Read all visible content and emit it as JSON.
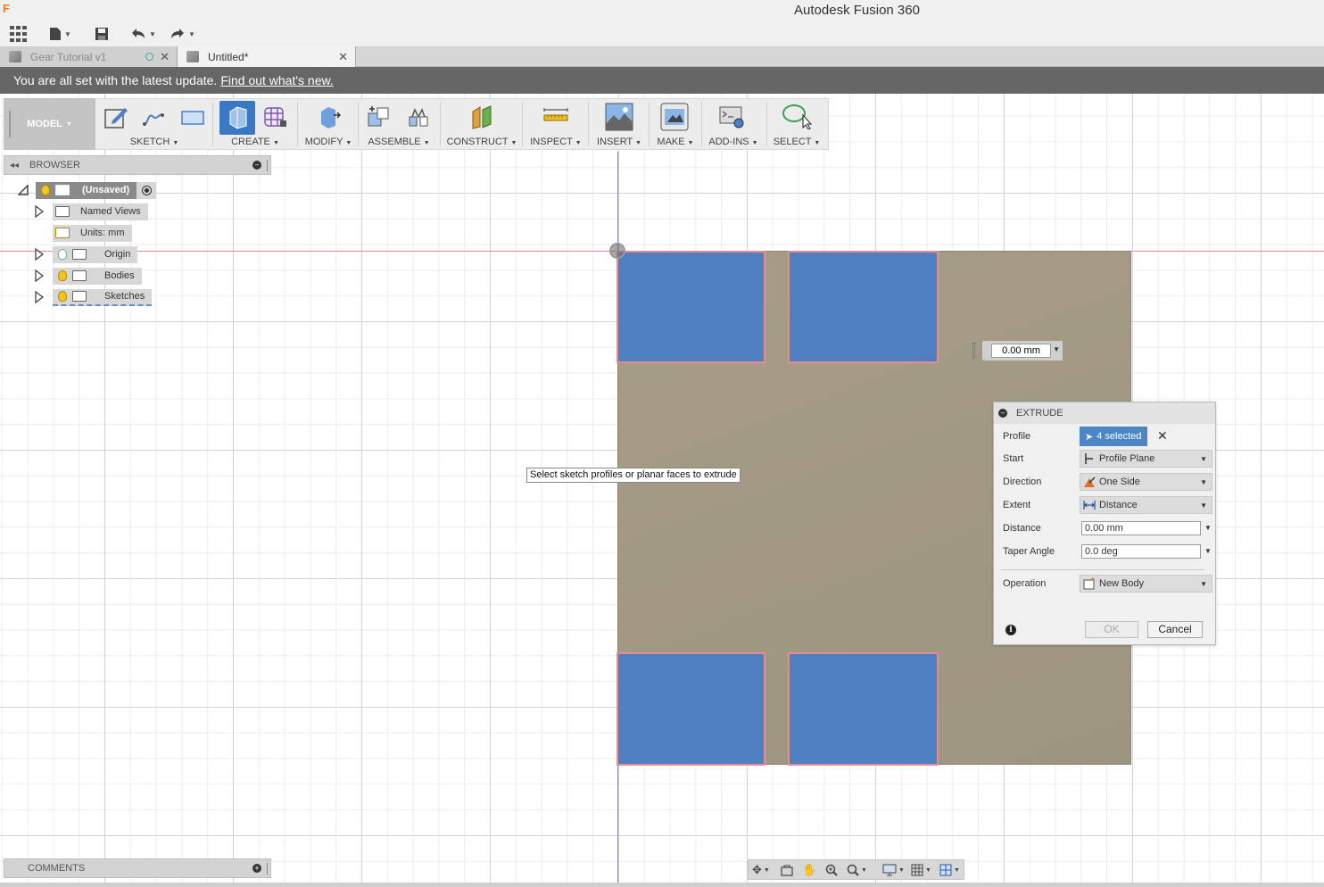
{
  "app": {
    "title": "Autodesk Fusion 360",
    "logo_letter": "F"
  },
  "tabs": [
    {
      "label": "Gear Tutorial v1",
      "active": false
    },
    {
      "label": "Untitled*",
      "active": true
    }
  ],
  "banner": {
    "text": "You are all set with the latest update.",
    "link": "Find out what's new."
  },
  "ribbon": {
    "workspace": "MODEL",
    "groups": [
      "SKETCH",
      "CREATE",
      "MODIFY",
      "ASSEMBLE",
      "CONSTRUCT",
      "INSPECT",
      "INSERT",
      "MAKE",
      "ADD-INS",
      "SELECT"
    ]
  },
  "browser": {
    "title": "BROWSER",
    "items": [
      {
        "label": "(Unsaved)"
      },
      {
        "label": "Named Views"
      },
      {
        "label": "Units: mm"
      },
      {
        "label": "Origin"
      },
      {
        "label": "Bodies"
      },
      {
        "label": "Sketches"
      }
    ]
  },
  "comments": {
    "title": "COMMENTS"
  },
  "canvas": {
    "tooltip": "Select sketch profiles or planar faces to extrude",
    "distance_value": "0.00 mm"
  },
  "extrude": {
    "title": "EXTRUDE",
    "rows": {
      "profile": {
        "label": "Profile",
        "value": "4 selected"
      },
      "start": {
        "label": "Start",
        "value": "Profile Plane"
      },
      "direction": {
        "label": "Direction",
        "value": "One Side"
      },
      "extent": {
        "label": "Extent",
        "value": "Distance"
      },
      "distance": {
        "label": "Distance",
        "value": "0.00 mm"
      },
      "taper": {
        "label": "Taper Angle",
        "value": "0.0 deg"
      },
      "operation": {
        "label": "Operation",
        "value": "New Body"
      }
    },
    "ok_label": "OK",
    "cancel_label": "Cancel"
  },
  "colors": {
    "profile_fill": "#4f7fc0",
    "profile_outline": "#e88a94",
    "plate": "#a69c87",
    "banner": "#666666",
    "selected_button": "#4c86c5"
  },
  "icons": {
    "quickbar": [
      "apps-grid-icon",
      "file-icon",
      "save-icon",
      "undo-icon",
      "redo-icon"
    ],
    "navbar": [
      "orbit-icon",
      "look-at-icon",
      "pan-icon",
      "zoom-icon",
      "fit-icon",
      "display-settings-icon",
      "grid-settings-icon",
      "viewports-icon"
    ]
  }
}
